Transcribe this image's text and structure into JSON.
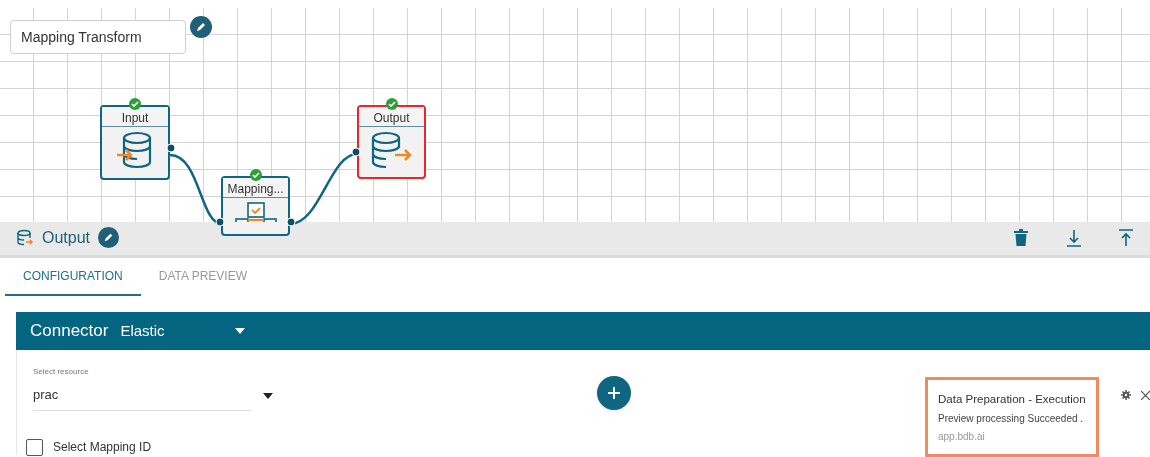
{
  "pipeline_name": {
    "value": "Mapping Transform"
  },
  "nodes": [
    {
      "label": "Input",
      "kind": "input",
      "selected": false,
      "status_ok": true
    },
    {
      "label": "Mapping...",
      "kind": "mapping",
      "selected": false,
      "status_ok": true
    },
    {
      "label": "Output",
      "kind": "output",
      "selected": true,
      "status_ok": true
    }
  ],
  "panel": {
    "title": "Output"
  },
  "tabs": [
    {
      "label": "CONFIGURATION",
      "selected": true
    },
    {
      "label": "DATA PREVIEW",
      "selected": false
    }
  ],
  "connector": {
    "label": "Connector",
    "value": "Elastic"
  },
  "resource": {
    "label": "Select resource",
    "value": "prac"
  },
  "mapping_id": {
    "label": "Select Mapping ID",
    "checked": false
  },
  "notification": {
    "title": "Data Preparation - Execution",
    "message": "Preview processing Succeeded .",
    "source": "app.bdb.ai"
  }
}
